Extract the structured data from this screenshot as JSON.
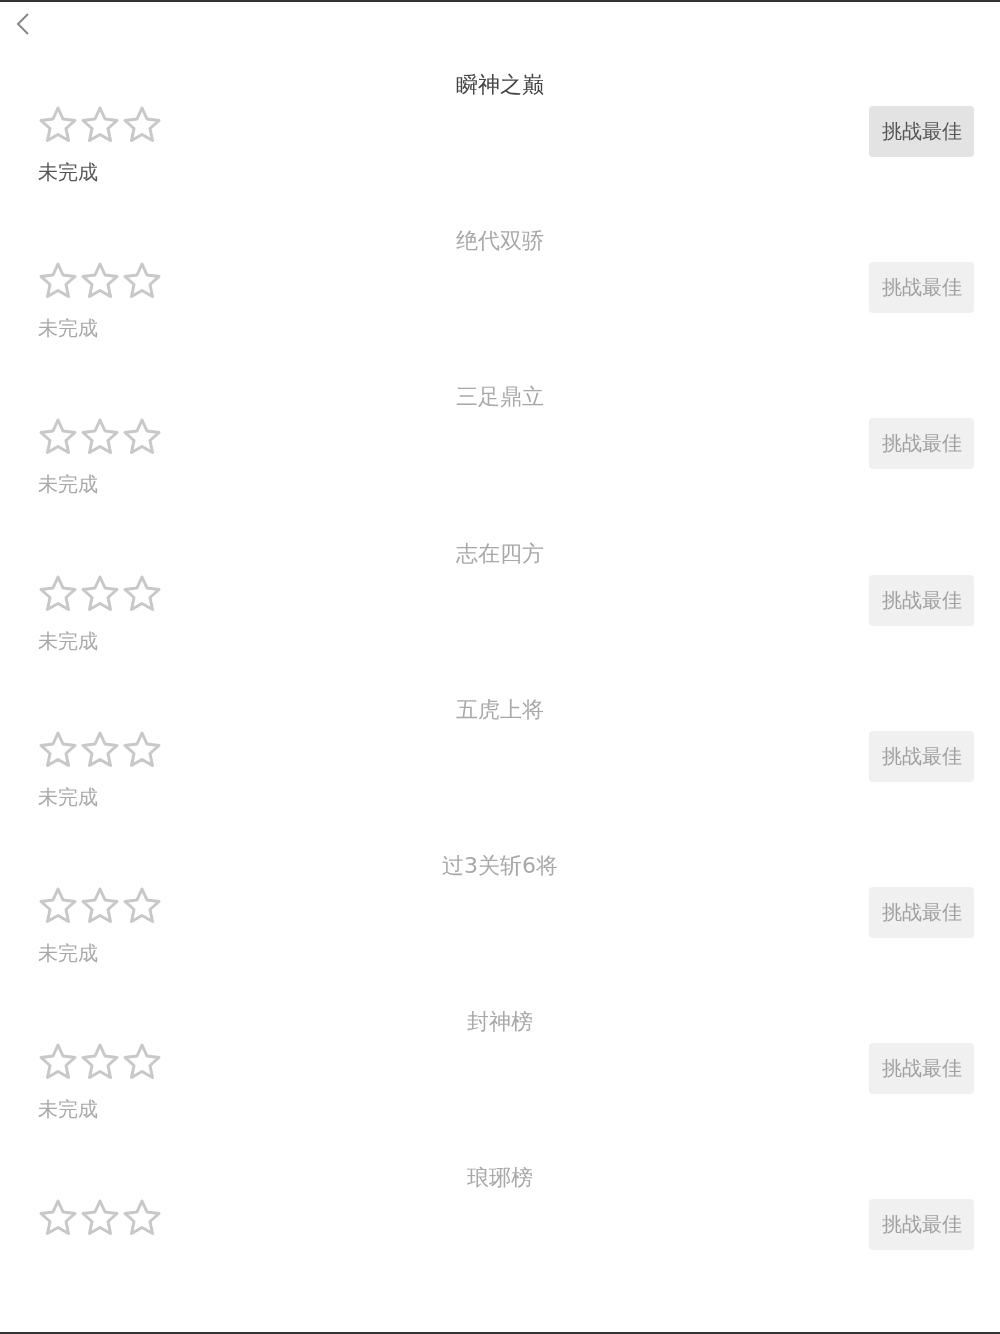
{
  "levels": [
    {
      "title": "瞬神之巅",
      "stars": 0,
      "status": "未完成",
      "button": "挑战最佳",
      "disabled": false
    },
    {
      "title": "绝代双骄",
      "stars": 0,
      "status": "未完成",
      "button": "挑战最佳",
      "disabled": true
    },
    {
      "title": "三足鼎立",
      "stars": 0,
      "status": "未完成",
      "button": "挑战最佳",
      "disabled": true
    },
    {
      "title": "志在四方",
      "stars": 0,
      "status": "未完成",
      "button": "挑战最佳",
      "disabled": true
    },
    {
      "title": "五虎上将",
      "stars": 0,
      "status": "未完成",
      "button": "挑战最佳",
      "disabled": true
    },
    {
      "title": "过3关斩6将",
      "stars": 0,
      "status": "未完成",
      "button": "挑战最佳",
      "disabled": true
    },
    {
      "title": "封神榜",
      "stars": 0,
      "status": "未完成",
      "button": "挑战最佳",
      "disabled": true
    },
    {
      "title": "琅琊榜",
      "stars": 0,
      "button": "挑战最佳",
      "disabled": true
    }
  ]
}
